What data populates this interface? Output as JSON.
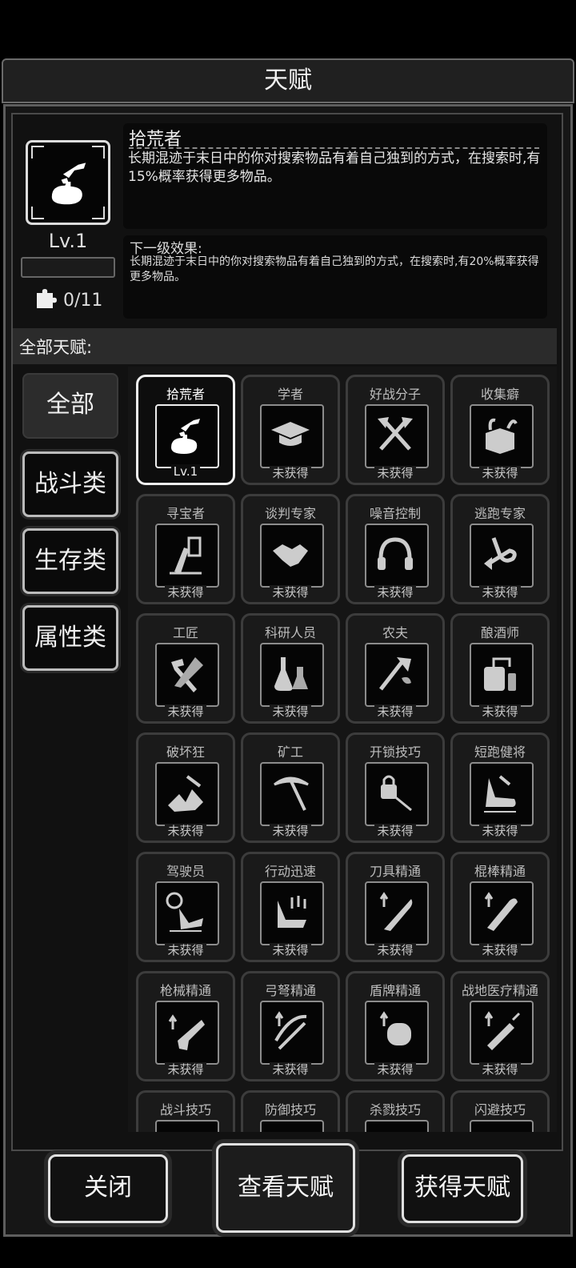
{
  "title": "天赋",
  "selected": {
    "name": "拾荒者",
    "level": "Lv.1",
    "description": "长期混迹于末日中的你对搜索物品有着自己独到的方式，在搜索时,有15%概率获得更多物品。",
    "pieces": "0/11",
    "next_title": "下一级效果:",
    "next_description": "长期混迹于末日中的你对搜索物品有着自己独到的方式，在搜索时,有20%概率获得更多物品。"
  },
  "all_label": "全部天赋:",
  "categories": [
    {
      "label": "全部"
    },
    {
      "label": "战斗类"
    },
    {
      "label": "生存类"
    },
    {
      "label": "属性类"
    }
  ],
  "talents": [
    {
      "name": "拾荒者",
      "status": "Lv.1",
      "icon": "scavenger-icon"
    },
    {
      "name": "学者",
      "status": "未获得",
      "icon": "graduation-cap-icon"
    },
    {
      "name": "好战分子",
      "status": "未获得",
      "icon": "crossed-axes-icon"
    },
    {
      "name": "收集癖",
      "status": "未获得",
      "icon": "box-collection-icon"
    },
    {
      "name": "寻宝者",
      "status": "未获得",
      "icon": "treasure-hunter-icon"
    },
    {
      "name": "谈判专家",
      "status": "未获得",
      "icon": "handshake-icon"
    },
    {
      "name": "噪音控制",
      "status": "未获得",
      "icon": "headphones-icon"
    },
    {
      "name": "逃跑专家",
      "status": "未获得",
      "icon": "escape-arrow-icon"
    },
    {
      "name": "工匠",
      "status": "未获得",
      "icon": "hammer-saw-icon"
    },
    {
      "name": "科研人员",
      "status": "未获得",
      "icon": "flask-icon"
    },
    {
      "name": "农夫",
      "status": "未获得",
      "icon": "farmer-axe-icon"
    },
    {
      "name": "酿酒师",
      "status": "未获得",
      "icon": "brewing-icon"
    },
    {
      "name": "破坏狂",
      "status": "未获得",
      "icon": "destruction-icon"
    },
    {
      "name": "矿工",
      "status": "未获得",
      "icon": "pickaxe-icon"
    },
    {
      "name": "开锁技巧",
      "status": "未获得",
      "icon": "lockpick-icon"
    },
    {
      "name": "短跑健将",
      "status": "未获得",
      "icon": "sprint-boot-icon"
    },
    {
      "name": "驾驶员",
      "status": "未获得",
      "icon": "driver-icon"
    },
    {
      "name": "行动迅速",
      "status": "未获得",
      "icon": "fast-move-icon"
    },
    {
      "name": "刀具精通",
      "status": "未获得",
      "icon": "machete-icon"
    },
    {
      "name": "棍棒精通",
      "status": "未获得",
      "icon": "club-icon"
    },
    {
      "name": "枪械精通",
      "status": "未获得",
      "icon": "pistol-icon"
    },
    {
      "name": "弓弩精通",
      "status": "未获得",
      "icon": "crossbow-icon"
    },
    {
      "name": "盾牌精通",
      "status": "未获得",
      "icon": "shield-icon"
    },
    {
      "name": "战地医疗精通",
      "status": "未获得",
      "icon": "syringe-icon"
    },
    {
      "name": "战斗技巧",
      "status": "",
      "icon": "combat-icon"
    },
    {
      "name": "防御技巧",
      "status": "",
      "icon": "defense-icon"
    },
    {
      "name": "杀戮技巧",
      "status": "",
      "icon": "kill-icon"
    },
    {
      "name": "闪避技巧",
      "status": "",
      "icon": "dodge-icon"
    }
  ],
  "buttons": {
    "close": "关闭",
    "view": "查看天赋",
    "acquire": "获得天赋"
  }
}
